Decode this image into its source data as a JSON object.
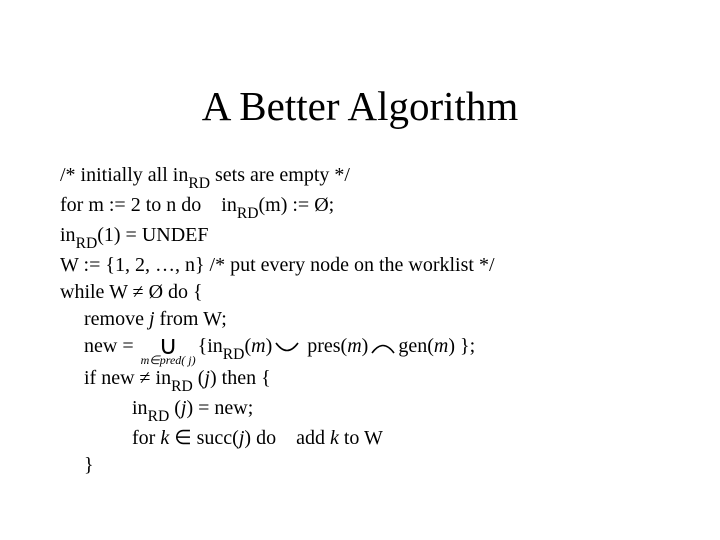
{
  "title": "A Better Algorithm",
  "lines": {
    "l0a": "/* initially all in",
    "l0b": "RD",
    "l0c": " sets are empty */",
    "l1a": "for m := 2 to n do in",
    "l1b": "RD",
    "l1c": "(m) := Ø;",
    "l2a": "in",
    "l2b": "RD",
    "l2c": "(1) = UNDEF",
    "l3": "W := {1, 2, …, n} /* put every node on the worklist */",
    "l4": "while W ≠ Ø do {",
    "l5a": "remove ",
    "l5j": "j",
    "l5b": " from W;",
    "l6a": "new = ",
    "l6u_top": "∪",
    "l6u_bot": "m∈pred( j)",
    "l6b": "{in",
    "l6rd": "RD",
    "l6c": "(",
    "l6m1": "m",
    "l6d": ")",
    "l6e": " pres(",
    "l6m2": "m",
    "l6f": ")",
    "l6g": "gen(",
    "l6m3": "m",
    "l6h": ") };",
    "l7a": "if new ≠ in",
    "l7rd": "RD",
    "l7b": " (",
    "l7j": "j",
    "l7c": ") then {",
    "l8a": "in",
    "l8rd": "RD",
    "l8b": " (",
    "l8j": "j",
    "l8c": ") = new;",
    "l9a": "for ",
    "l9k": "k",
    "l9b": " ∈ succ(",
    "l9j": "j",
    "l9c": ") do add ",
    "l9k2": "k",
    "l9d": " to W",
    "l10": "}"
  }
}
